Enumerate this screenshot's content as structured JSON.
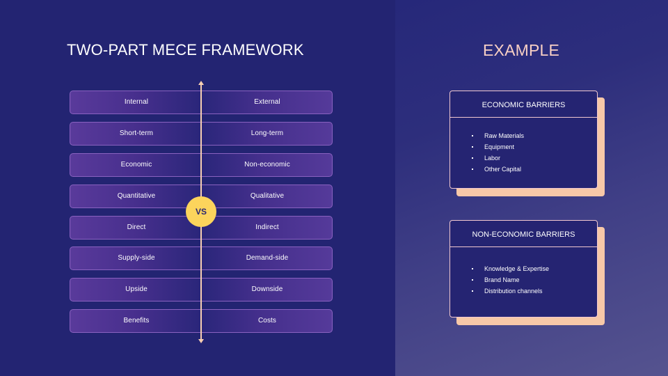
{
  "left": {
    "title": "TWO-PART MECE FRAMEWORK",
    "center_badge": "VS",
    "rows": [
      {
        "left": "Internal",
        "right": "External"
      },
      {
        "left": "Short-term",
        "right": "Long-term"
      },
      {
        "left": "Economic",
        "right": "Non-economic"
      },
      {
        "left": "Quantitative",
        "right": "Qualitative"
      },
      {
        "left": "Direct",
        "right": "Indirect"
      },
      {
        "left": "Supply-side",
        "right": "Demand-side"
      },
      {
        "left": "Upside",
        "right": "Downside"
      },
      {
        "left": "Benefits",
        "right": "Costs"
      }
    ]
  },
  "right": {
    "title": "EXAMPLE",
    "cards": [
      {
        "header": "ECONOMIC BARRIERS",
        "items": [
          "Raw Materials",
          "Equipment",
          "Labor",
          "Other Capital"
        ]
      },
      {
        "header": "NON-ECONOMIC BARRIERS",
        "items": [
          "Knowledge & Expertise",
          "Brand Name",
          "Distribution channels"
        ]
      }
    ]
  },
  "colors": {
    "background": "#232472",
    "accent_peach": "#f7cfb2",
    "vs_badge": "#fcd45c",
    "row_border": "#8a62c0",
    "example_title": "#f7cfc4"
  }
}
